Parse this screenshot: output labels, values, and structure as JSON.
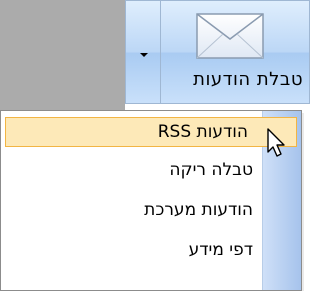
{
  "ribbon_button": {
    "label": "טבלת הודעות",
    "icon": "envelope-icon",
    "dropdown_icon": "dropdown-arrow-icon"
  },
  "menu": {
    "items": [
      {
        "label": "הודעות RSS",
        "highlighted": true
      },
      {
        "label": "טבלה ריקה",
        "highlighted": false
      },
      {
        "label": "הודעות מערכת",
        "highlighted": false
      },
      {
        "label": "דפי מידע",
        "highlighted": false
      }
    ]
  },
  "colors": {
    "highlight_fill": "#fde9b8",
    "highlight_border": "#f2b544",
    "ribbon_gradient_top": "#dfeefd",
    "ribbon_gradient_bottom": "#a9cbf2"
  }
}
